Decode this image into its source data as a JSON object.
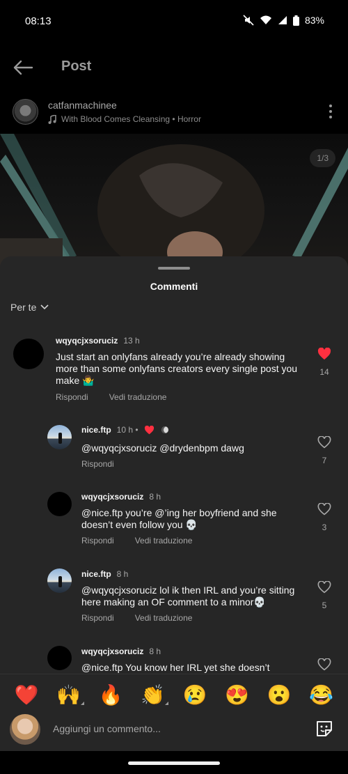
{
  "status_bar": {
    "time": "08:13",
    "battery": "83%"
  },
  "header": {
    "title": "Post"
  },
  "post": {
    "username": "catfanmachinee",
    "music": "With Blood Comes Cleansing • Horror",
    "counter": "1/3"
  },
  "sheet": {
    "title": "Commenti",
    "sort": "Per te"
  },
  "comments": [
    {
      "username": "wqyqcjxsoruciz",
      "ago": "13 h",
      "text": "Just start an onlyfans already you’re already showing more than some onlyfans creators every single post you make 🤷‍♂️",
      "reply": "Rispondi",
      "translate": "Vedi traduzione",
      "likes": "14",
      "liked": true
    },
    {
      "username": "nice.ftp",
      "ago": "10 h •",
      "text": "@wqyqcjxsoruciz @drydenbpm dawg",
      "reply": "Rispondi",
      "likes": "7",
      "liked": false
    },
    {
      "username": "wqyqcjxsoruciz",
      "ago": "8 h",
      "text": "@nice.ftp you’re @’ing her boyfriend and she doesn’t even follow you 💀",
      "reply": "Rispondi",
      "translate": "Vedi traduzione",
      "likes": "3",
      "liked": false
    },
    {
      "username": "nice.ftp",
      "ago": "8 h",
      "text": "@wqyqcjxsoruciz lol ik then IRL and you’re sitting here making an OF comment to a minor💀",
      "reply": "Rispondi",
      "translate": "Vedi traduzione",
      "likes": "5",
      "liked": false
    },
    {
      "username": "wqyqcjxsoruciz",
      "ago": "8 h",
      "text": "@nice.ftp You know her IRL yet she doesn’t",
      "liked": false
    }
  ],
  "emojis": [
    "❤️",
    "🙌",
    "🔥",
    "👏",
    "😢",
    "😍",
    "😮",
    "😂"
  ],
  "input": {
    "placeholder": "Aggiungi un commento..."
  },
  "colors": {
    "sheet": "#262626",
    "like_red": "#ff3040",
    "text_muted": "#a8a8a8"
  }
}
